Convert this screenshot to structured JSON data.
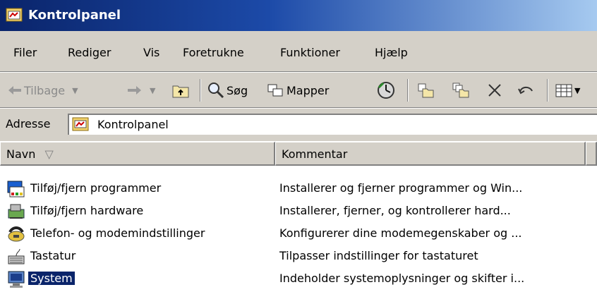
{
  "window": {
    "title": "Kontrolpanel",
    "icon": "control-panel-icon"
  },
  "menu": [
    "Filer",
    "Rediger",
    "Vis",
    "Foretrukne",
    "Funktioner",
    "Hjælp"
  ],
  "toolbar": {
    "back_label": "Tilbage",
    "search_label": "Søg",
    "folders_label": "Mapper"
  },
  "address": {
    "label": "Adresse",
    "value": "Kontrolpanel"
  },
  "columns": {
    "name": "Navn",
    "comment": "Kommentar",
    "sort_indicator": "▽"
  },
  "items": [
    {
      "name": "Tilføj/fjern programmer",
      "comment": "Installerer og fjerner programmer og Win...",
      "icon": "add-remove-programs-icon"
    },
    {
      "name": "Tilføj/fjern hardware",
      "comment": "Installerer, fjerner, og kontrollerer hard...",
      "icon": "add-remove-hardware-icon"
    },
    {
      "name": "Telefon- og modemindstillinger",
      "comment": "Konfigurerer dine modemegenskaber og ...",
      "icon": "phone-modem-icon"
    },
    {
      "name": "Tastatur",
      "comment": "Tilpasser indstillinger for tastaturet",
      "icon": "keyboard-icon"
    },
    {
      "name": "System",
      "comment": "Indeholder systemoplysninger og skifter i...",
      "icon": "system-icon",
      "selected": true
    }
  ],
  "colors": {
    "title_start": "#0a246a",
    "title_end": "#a6caf0",
    "chrome": "#d4d0c8",
    "selection": "#0a246a"
  }
}
